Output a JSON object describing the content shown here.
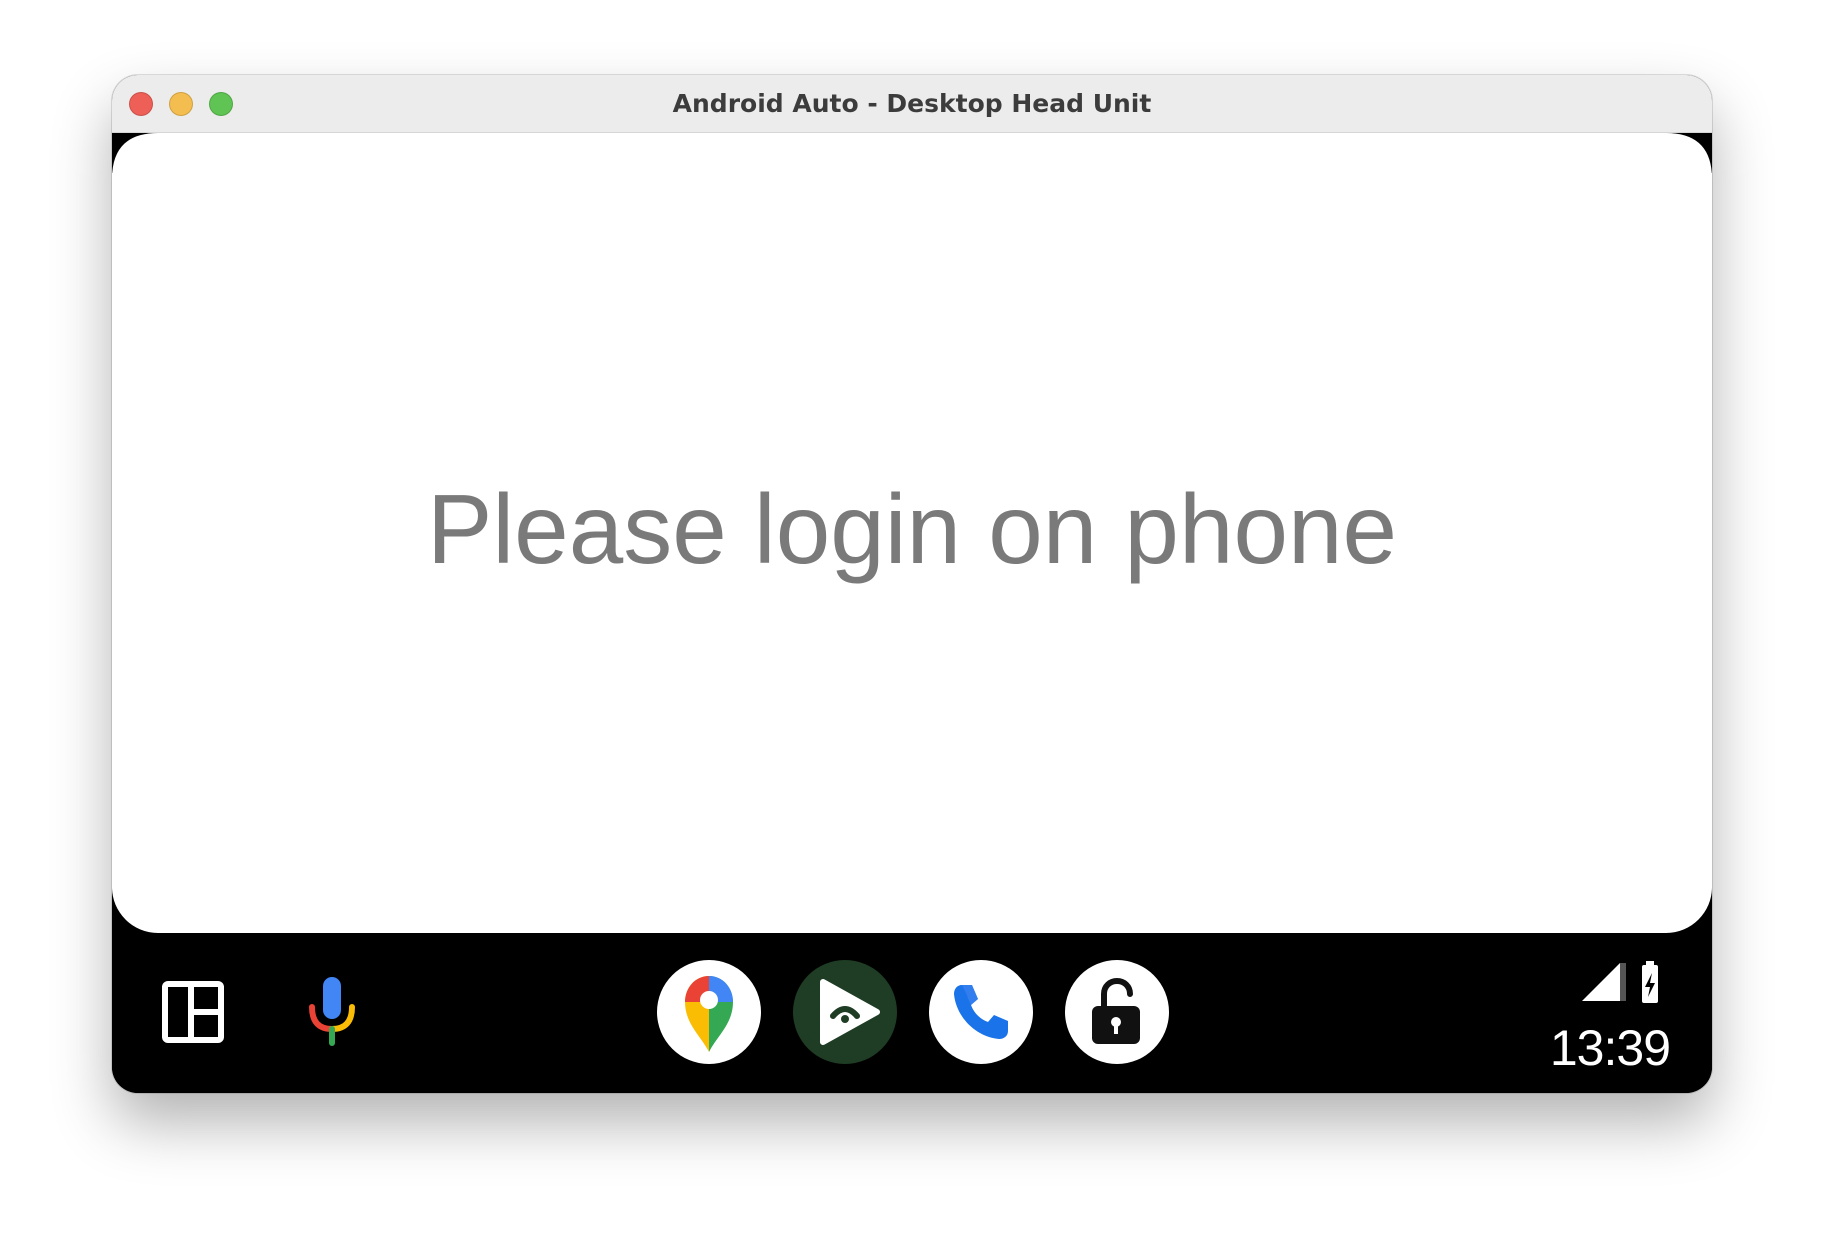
{
  "window": {
    "title": "Android Auto - Desktop Head Unit"
  },
  "screen": {
    "message": "Please login on phone"
  },
  "taskbar": {
    "dashboard_icon": "dashboard-grid-icon",
    "voice_icon": "google-mic-icon",
    "apps": [
      {
        "name": "Google Maps",
        "icon": "google-maps-icon"
      },
      {
        "name": "Play Music",
        "icon": "play-app-icon"
      },
      {
        "name": "Phone",
        "icon": "phone-icon"
      },
      {
        "name": "Lock",
        "icon": "unlock-icon"
      }
    ],
    "clock": "13:39"
  },
  "colors": {
    "close": "#ee5f57",
    "minimize": "#f4bd4f",
    "maximize": "#5fc453",
    "message_text": "#7a7a7a",
    "bar_background": "#000000",
    "play_app_background": "#1f3d24"
  }
}
